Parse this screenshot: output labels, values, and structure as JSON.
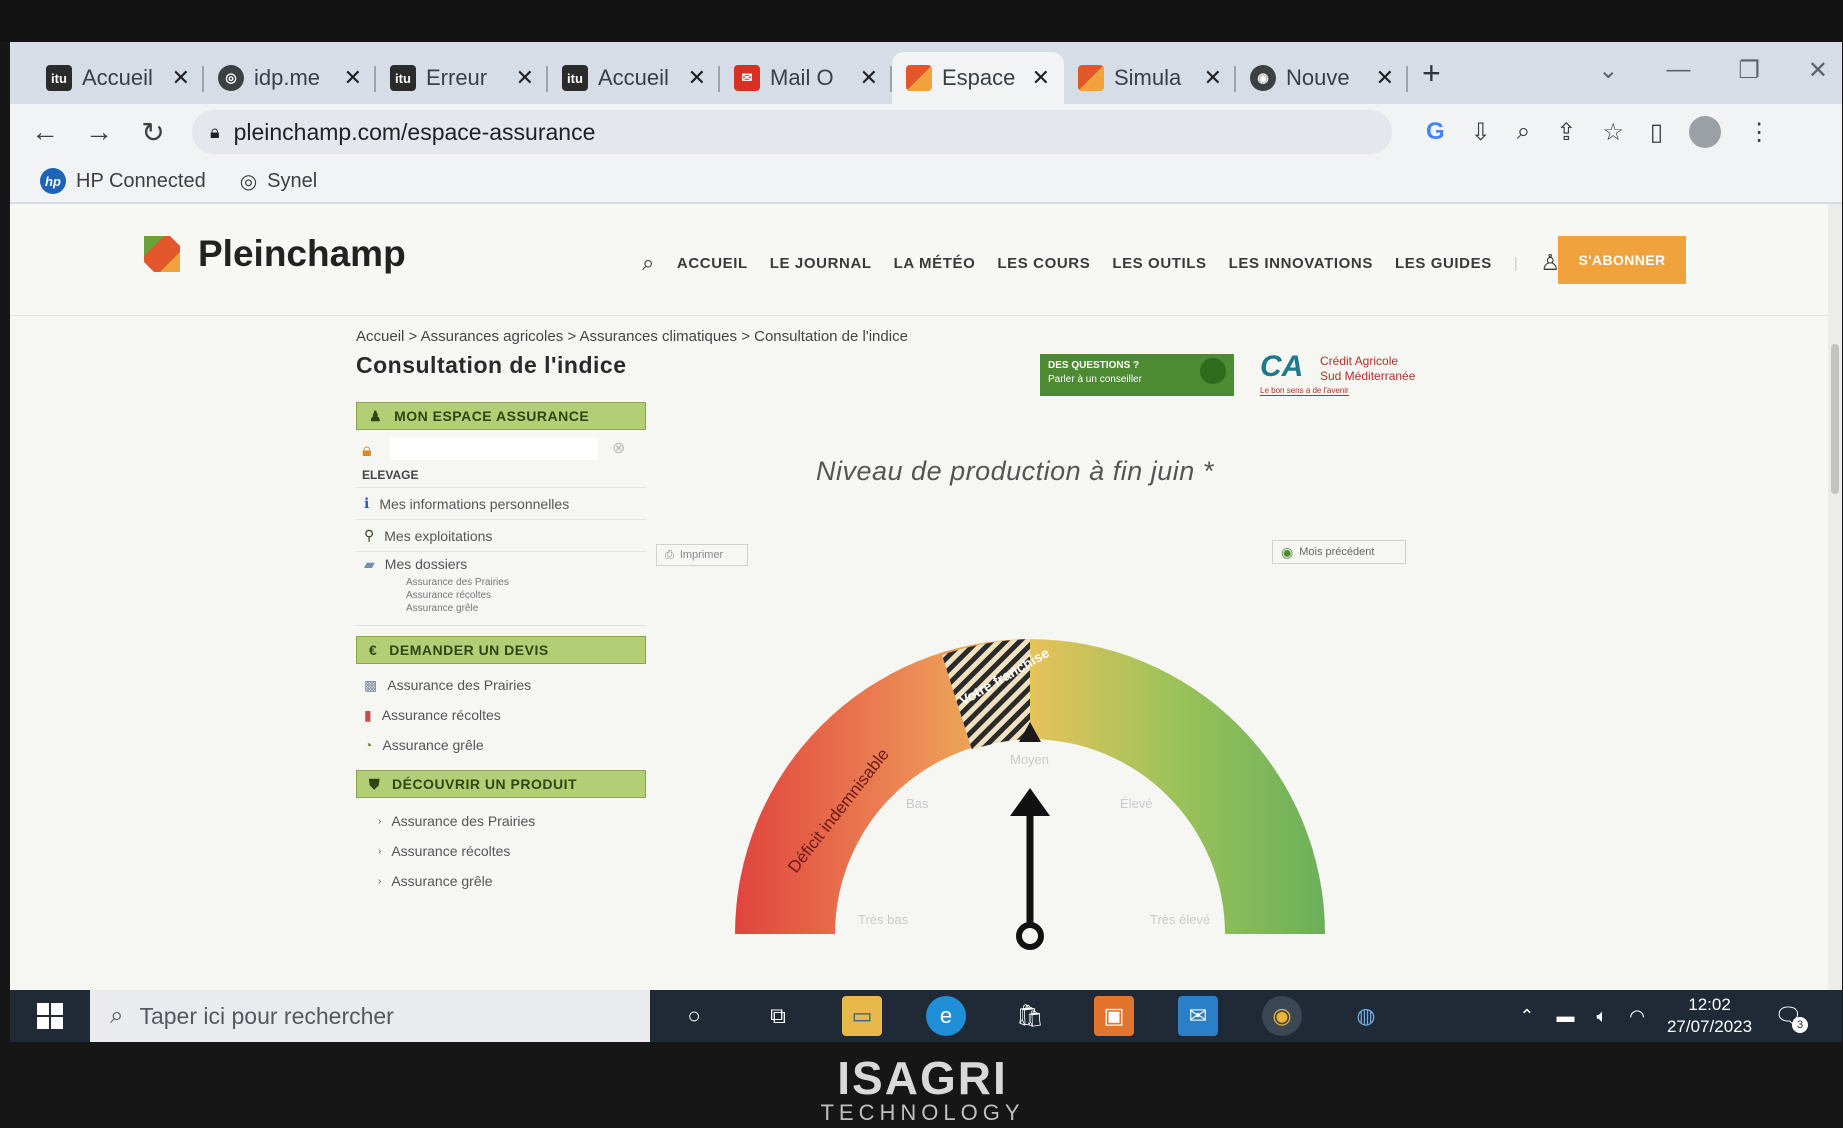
{
  "browser": {
    "tabs": [
      {
        "label": "Accueil",
        "icon": "itu-logo-icon",
        "color": "#2b2b2b"
      },
      {
        "label": "idp.me",
        "icon": "globe-icon",
        "color": "#3c4043"
      },
      {
        "label": "Erreur",
        "icon": "itu-logo-icon",
        "color": "#2b2b2b"
      },
      {
        "label": "Accueil",
        "icon": "itu-logo-icon",
        "color": "#2b2b2b"
      },
      {
        "label": "Mail O",
        "icon": "mail-icon",
        "color": "#d93025"
      },
      {
        "label": "Espace",
        "icon": "pleinchamp-icon",
        "color": "#e2562b"
      },
      {
        "label": "Simula",
        "icon": "pleinchamp-icon",
        "color": "#e2562b"
      },
      {
        "label": "Nouve",
        "icon": "chrome-icon",
        "color": "#3c4043"
      }
    ],
    "new_tab": "+",
    "url": "pleinchamp.com/espace-assurance",
    "bookmarks": [
      "HP Connected",
      "Synel"
    ]
  },
  "site": {
    "brand": "Pleinchamp",
    "nav": [
      "ACCUEIL",
      "LE JOURNAL",
      "LA MÉTÉO",
      "LES COURS",
      "LES OUTILS",
      "LES INNOVATIONS",
      "LES GUIDES"
    ],
    "subscribe": "S'ABONNER",
    "breadcrumb": "Accueil > Assurances agricoles > Assurances climatiques > Consultation de l'indice",
    "page_title": "Consultation de l'indice",
    "questions_banner": {
      "line1": "DES QUESTIONS ?",
      "line2": "Parler à un conseiller"
    },
    "partner": {
      "name1": "Crédit Agricole",
      "name2": "Sud Méditerranée",
      "tagline": "Le bon sens a de l'avenir"
    }
  },
  "sidebar": {
    "espace_title": "MON ESPACE ASSURANCE",
    "profile_type": "ELEVAGE",
    "espace_items": [
      "Mes informations personnelles",
      "Mes exploitations",
      "Mes dossiers"
    ],
    "dossiers_sub": [
      "Assurance des Prairies",
      "Assurance récoltes",
      "Assurance grêle"
    ],
    "devis_title": "DEMANDER UN DEVIS",
    "devis_items": [
      "Assurance des Prairies",
      "Assurance récoltes",
      "Assurance grêle"
    ],
    "produit_title": "DÉCOUVRIR UN PRODUIT",
    "produit_items": [
      "Assurance des Prairies",
      "Assurance récoltes",
      "Assurance grêle"
    ]
  },
  "gauge": {
    "title": "Niveau de production à fin juin *",
    "print_label": "Imprimer",
    "prev_label": "Mois précédent",
    "deficit_label": "Déficit indemnisable",
    "franchise_label": "Votre franchise",
    "levels": [
      "Très bas",
      "Bas",
      "Moyen",
      "Élevé",
      "Très élevé"
    ],
    "needle_position": 0.5
  },
  "taskbar": {
    "search_placeholder": "Taper ici pour rechercher",
    "time": "12:02",
    "date": "27/07/2023",
    "notifications": "3"
  },
  "bezel": {
    "brand_line1": "ISAGRI",
    "brand_line2": "TECHNOLOGY"
  }
}
